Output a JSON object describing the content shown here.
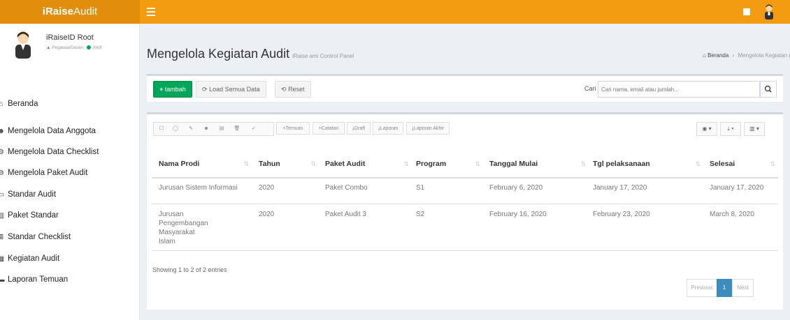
{
  "app": {
    "logo_bold": "iRaise",
    "logo_rest": "Audit"
  },
  "user": {
    "name": "iRaiseID Root",
    "role": "Pegawai/Dosen",
    "status": "Aktif"
  },
  "sidebar": {
    "items": [
      {
        "label": "Beranda",
        "icon": "home-icon"
      },
      {
        "label": "Mengelola Data Anggota",
        "icon": "users-icon"
      },
      {
        "label": "Mengelola Data Checklist",
        "icon": "cogs-icon"
      },
      {
        "label": "Mengelola Paket Audit",
        "icon": "cogs-icon"
      },
      {
        "label": "Standar Audit",
        "icon": "desktop-icon"
      },
      {
        "label": "Paket Standar",
        "icon": "chart-icon"
      },
      {
        "label": "Standar Checklist",
        "icon": "list-icon"
      },
      {
        "label": "Kegiatan Audit",
        "icon": "table-icon"
      },
      {
        "label": "Laporan Temuan",
        "icon": "bars-icon"
      }
    ]
  },
  "header": {
    "title": "Mengelola Kegiatan Audit",
    "subtitle": "iRaise ami Control Panel",
    "breadcrumb_home": "Beranda",
    "breadcrumb_current": "Mengelola Kegiatan Audit"
  },
  "actions": {
    "add_label": "tambah",
    "load_all_label": "Load Semua Data",
    "reset_label": "Reset",
    "search_label": "Cari",
    "search_placeholder": "Cari nama, email atau jumlah..."
  },
  "toolbar": {
    "temuan_label": "+Temuan",
    "catatan_label": "+Catatan",
    "draft_label": "Draft",
    "laporan_label": "Laporan",
    "laporan_akhir_label": "Laporan Akhir"
  },
  "table": {
    "columns": [
      "Nama Prodi",
      "Tahun",
      "Paket Audit",
      "Program",
      "Tanggal Mulai",
      "Tgl pelaksanaan",
      "Selesai"
    ],
    "rows": [
      [
        "Jurusan Sistem Informasi",
        "2020",
        "Paket Combo",
        "S1",
        "February 6, 2020",
        "January 17, 2020",
        "January 17, 2020"
      ],
      [
        "Jurusan Pengembangan Masyarakat Islam",
        "2020",
        "Paket Audit 3",
        "S2",
        "February 16, 2020",
        "February 23, 2020",
        "March 8, 2020"
      ]
    ],
    "info": "Showing 1 to 2 of 2 entries"
  },
  "pagination": {
    "previous": "Previous",
    "page": "1",
    "next": "Next"
  },
  "colors": {
    "topbar": "#f39c12",
    "logo_bg": "#e08e0b",
    "green": "#00a65a",
    "blue": "#3c8dbc"
  }
}
